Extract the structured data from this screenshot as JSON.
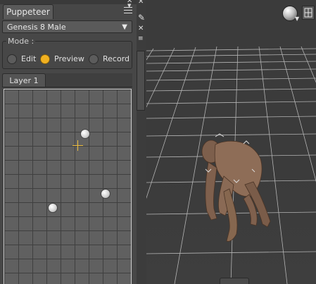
{
  "pane": {
    "tab_label": "Puppeteer",
    "figure_select": {
      "value": "Genesis 8 Male"
    },
    "mode": {
      "label": "Mode :",
      "options": [
        {
          "label": "Edit",
          "selected": false
        },
        {
          "label": "Preview",
          "selected": true
        },
        {
          "label": "Record",
          "selected": false
        }
      ]
    },
    "layer_tab": "Layer 1"
  },
  "icons": {
    "pane_menu": "hamburger-menu-icon",
    "close": "close-icon",
    "select_caret": "chevron-down-icon",
    "pin": "pin-icon",
    "viewport_sphere": "render-style-sphere-icon",
    "viewport_layout": "viewport-layout-icon"
  },
  "colors": {
    "accent_radio": "#f0b020",
    "panel_bg": "#474747",
    "grid_bg": "#606060",
    "viewport_bg": "#3b3b3b"
  }
}
